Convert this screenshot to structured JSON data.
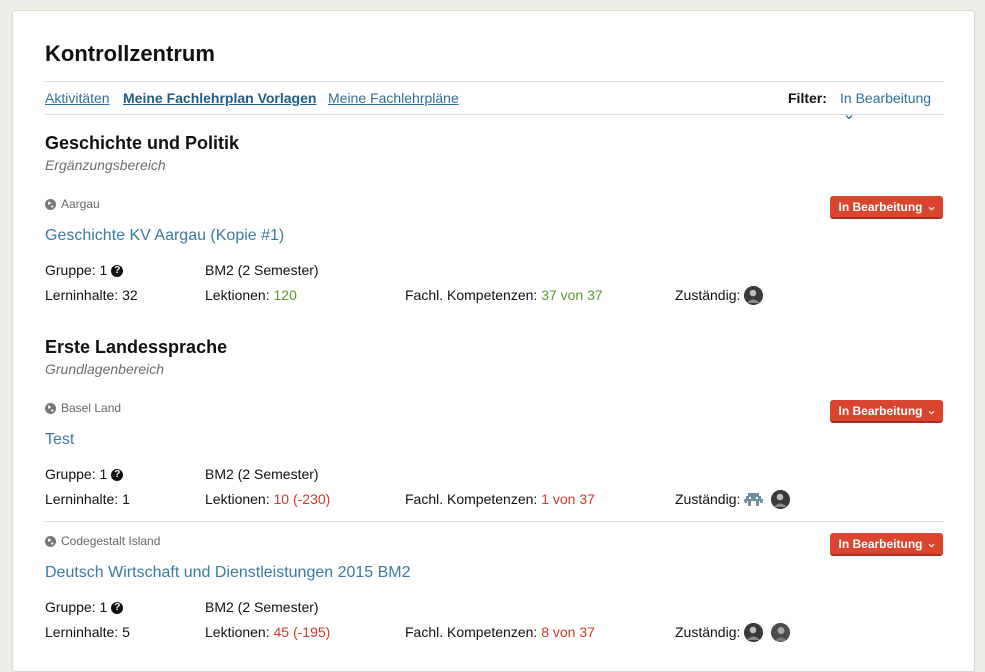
{
  "page": {
    "title": "Kontrollzentrum"
  },
  "nav": {
    "tabs": [
      {
        "label": "Aktivitäten"
      },
      {
        "label": "Meine Fachlehrplan Vorlagen"
      },
      {
        "label": "Meine Fachlehrpläne"
      }
    ],
    "filter_label": "Filter:",
    "filter_value": "In Bearbeitung"
  },
  "areas": [
    {
      "title": "Geschichte und Politik",
      "subtitle": "Ergänzungsbereich"
    },
    {
      "title": "Erste Landessprache",
      "subtitle": "Grundlagenbereich"
    }
  ],
  "plans": [
    {
      "region": "Aargau",
      "name": "Geschichte KV Aargau (Kopie #1)",
      "status": "In Bearbeitung",
      "gruppe_label": "Gruppe:",
      "gruppe_value": "1",
      "program": "BM2 (2 Semester)",
      "lerninhalte_label": "Lerninhalte:",
      "lerninhalte_value": "32",
      "lektionen_label": "Lektionen:",
      "lektionen_value": "120",
      "kompetenzen_label": "Fachl. Kompetenzen:",
      "kompetenzen_value": "37 von 37",
      "zustaendig_label": "Zuständig:",
      "value_color": "green"
    },
    {
      "region": "Basel Land",
      "name": "Test",
      "status": "In Bearbeitung",
      "gruppe_label": "Gruppe:",
      "gruppe_value": "1",
      "program": "BM2 (2 Semester)",
      "lerninhalte_label": "Lerninhalte:",
      "lerninhalte_value": "1",
      "lektionen_label": "Lektionen:",
      "lektionen_value": "10 (-230)",
      "kompetenzen_label": "Fachl. Kompetenzen:",
      "kompetenzen_value": "1 von 37",
      "zustaendig_label": "Zuständig:",
      "value_color": "red"
    },
    {
      "region": "Codegestalt Island",
      "name": "Deutsch Wirtschaft und Dienstleistungen 2015 BM2",
      "status": "In Bearbeitung",
      "gruppe_label": "Gruppe:",
      "gruppe_value": "1",
      "program": "BM2 (2 Semester)",
      "lerninhalte_label": "Lerninhalte:",
      "lerninhalte_value": "5",
      "lektionen_label": "Lektionen:",
      "lektionen_value": "45 (-195)",
      "kompetenzen_label": "Fachl. Kompetenzen:",
      "kompetenzen_value": "8 von 37",
      "zustaendig_label": "Zuständig:",
      "value_color": "red"
    }
  ],
  "colors": {
    "accent": "#3b7aa3",
    "status_button": "#d9452f",
    "positive": "#5c9a2e",
    "negative": "#cf3a2c"
  },
  "icons": [
    "globe-icon",
    "chevron-down-icon",
    "help-icon",
    "avatar"
  ]
}
